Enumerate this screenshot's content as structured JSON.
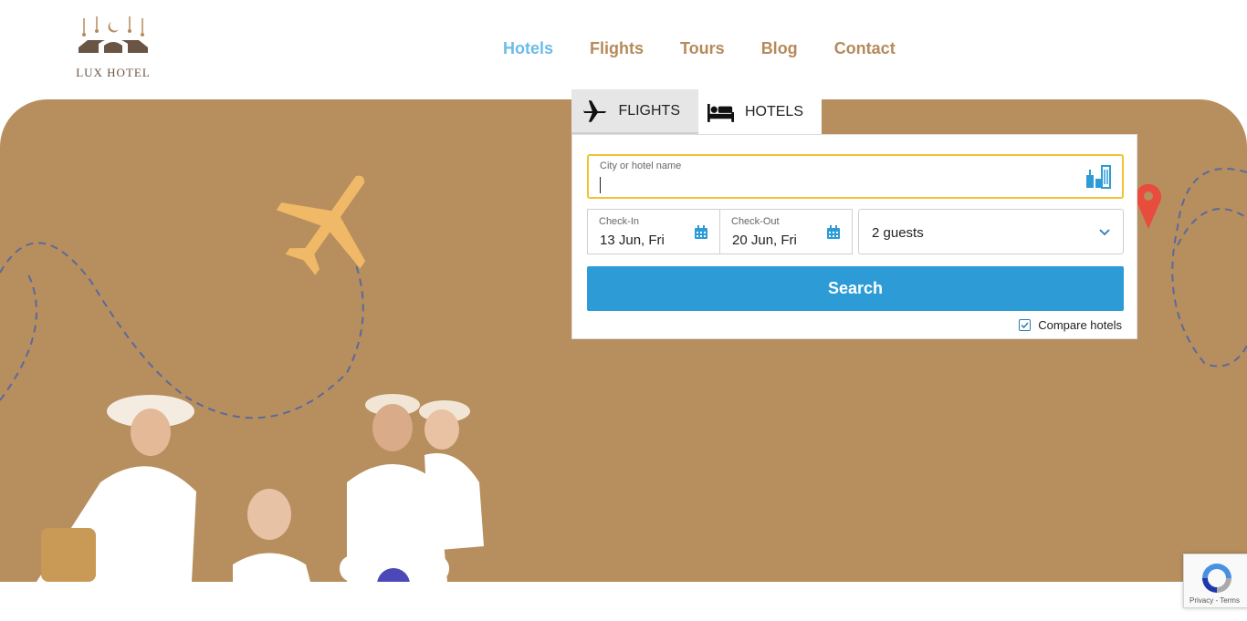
{
  "header": {
    "logo_text": "LUX HOTEL",
    "nav": [
      {
        "label": "Hotels",
        "active": true
      },
      {
        "label": "Flights",
        "active": false
      },
      {
        "label": "Tours",
        "active": false
      },
      {
        "label": "Blog",
        "active": false
      },
      {
        "label": "Contact",
        "active": false
      }
    ]
  },
  "search_widget": {
    "tabs": [
      {
        "label": "FLIGHTS",
        "icon": "airplane-icon",
        "active": false
      },
      {
        "label": "HOTELS",
        "icon": "bed-icon",
        "active": true
      }
    ],
    "city_field": {
      "label": "City or hotel name",
      "value": ""
    },
    "check_in": {
      "label": "Check-In",
      "value": "13 Jun, Fri"
    },
    "check_out": {
      "label": "Check-Out",
      "value": "20 Jun, Fri"
    },
    "guests": {
      "value": "2 guests"
    },
    "search_button": "Search",
    "compare_label": "Compare hotels"
  },
  "recaptcha": {
    "text": "Privacy - Terms"
  },
  "colors": {
    "brand_tan": "#b78e5e",
    "nav_text": "#b58a5a",
    "nav_active": "#6bbce8",
    "search_blue": "#2c9bd6",
    "focus_yellow": "#f2c232",
    "pin_red": "#e84c3d"
  }
}
